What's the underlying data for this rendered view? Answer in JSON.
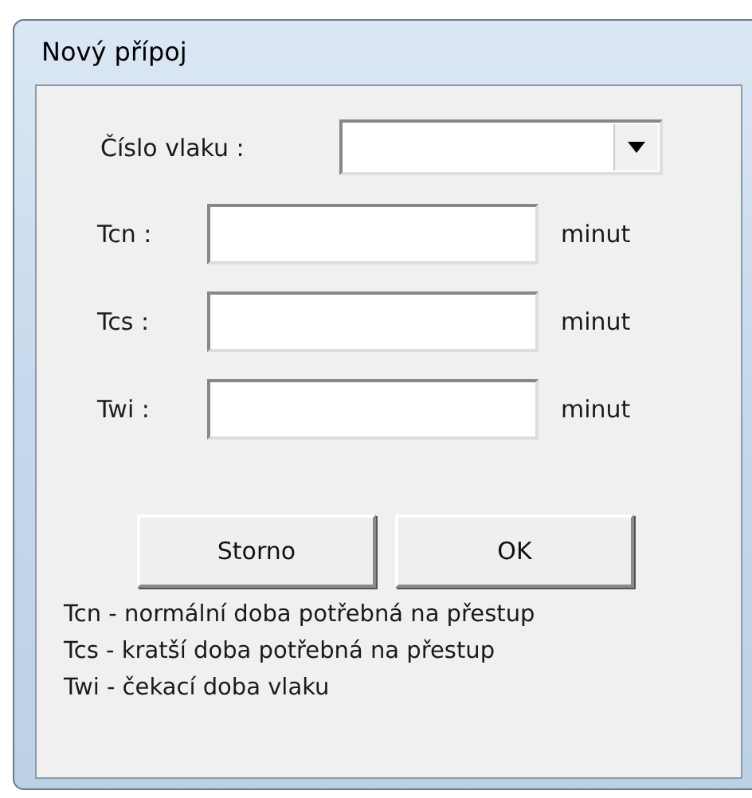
{
  "window": {
    "title": "Nový přípoj"
  },
  "train": {
    "label": "Číslo vlaku :"
  },
  "fields": [
    {
      "label": "Tcn :",
      "unit": "minut"
    },
    {
      "label": "Tcs :",
      "unit": "minut"
    },
    {
      "label": "Twi :",
      "unit": "minut"
    }
  ],
  "buttons": [
    "Storno",
    "OK"
  ],
  "legend": [
    "Tcn - normální doba potřebná na přestup",
    "Tcs - kratší doba potřebná na přestup",
    "Twi - čekací doba vlaku"
  ]
}
